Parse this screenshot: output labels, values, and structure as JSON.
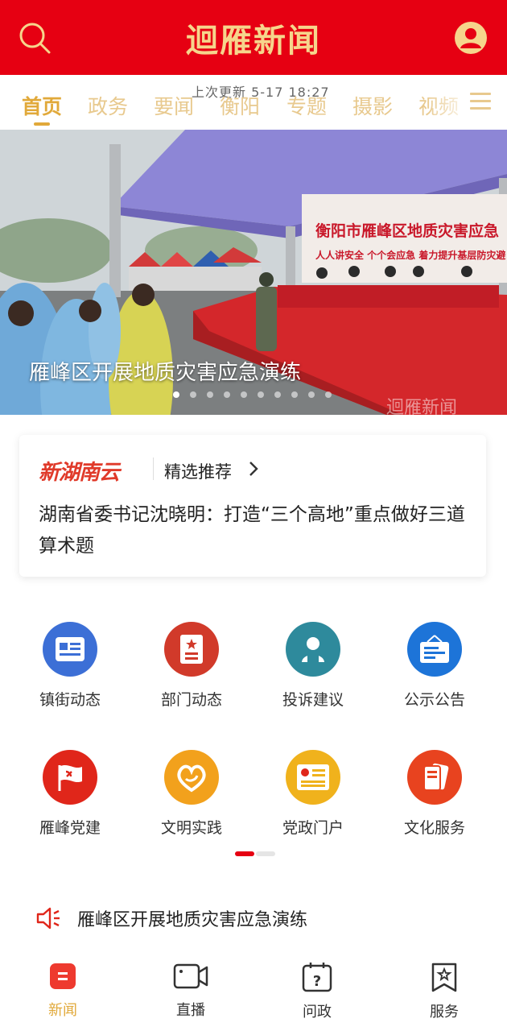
{
  "header": {
    "title": "迴雁新闻",
    "search_icon": "search-icon",
    "user_icon": "user-icon"
  },
  "tabs": {
    "refresh_text": "上次更新 5-17 18:27",
    "items": [
      {
        "label": "首页",
        "active": true
      },
      {
        "label": "政务"
      },
      {
        "label": "要闻"
      },
      {
        "label": "衡阳"
      },
      {
        "label": "专题"
      },
      {
        "label": "摄影"
      },
      {
        "label": "视频"
      }
    ],
    "menu_icon": "menu-icon"
  },
  "banner": {
    "headline": "雁峰区开展地质灾害应急演练",
    "stage_banner_line1": "衡阳市雁峰区地质灾害应急",
    "stage_banner_line2": "人人讲安全 个个会应急 着力提升基层防灾避",
    "watermark": "迴雁新闻",
    "slide_count": 10,
    "active_slide": 0
  },
  "recommend": {
    "brand": "新湖南云",
    "label": "精选推荐",
    "text": "湖南省委书记沈晓明：打造“三个高地”重点做好三道算术题"
  },
  "grid": [
    {
      "label": "镇街动态",
      "icon": "news-card-icon",
      "color": "#3c6fd6"
    },
    {
      "label": "部门动态",
      "icon": "document-star-icon",
      "color": "#d13a2a"
    },
    {
      "label": "投诉建议",
      "icon": "customer-service-icon",
      "color": "#2e8a9c"
    },
    {
      "label": "公示公告",
      "icon": "notice-board-icon",
      "color": "#1d74d8"
    },
    {
      "label": "雁峰党建",
      "icon": "party-flag-icon",
      "color": "#e0261a"
    },
    {
      "label": "文明实践",
      "icon": "heart-icon",
      "color": "#f2a11c"
    },
    {
      "label": "党政门户",
      "icon": "party-portal-icon",
      "color": "#f0b21c"
    },
    {
      "label": "文化服务",
      "icon": "cards-icon",
      "color": "#e8431f"
    }
  ],
  "notice": {
    "icon": "speaker-icon",
    "text": "雁峰区开展地质灾害应急演练"
  },
  "bottom_nav": [
    {
      "label": "新闻",
      "icon": "news-icon",
      "active": true
    },
    {
      "label": "直播",
      "icon": "video-camera-icon"
    },
    {
      "label": "问政",
      "icon": "question-calendar-icon"
    },
    {
      "label": "服务",
      "icon": "bookmark-star-icon"
    }
  ],
  "colors": {
    "brand_red": "#e60012",
    "accent_gold": "#e1a93a",
    "title_gold": "#f6d58c"
  }
}
